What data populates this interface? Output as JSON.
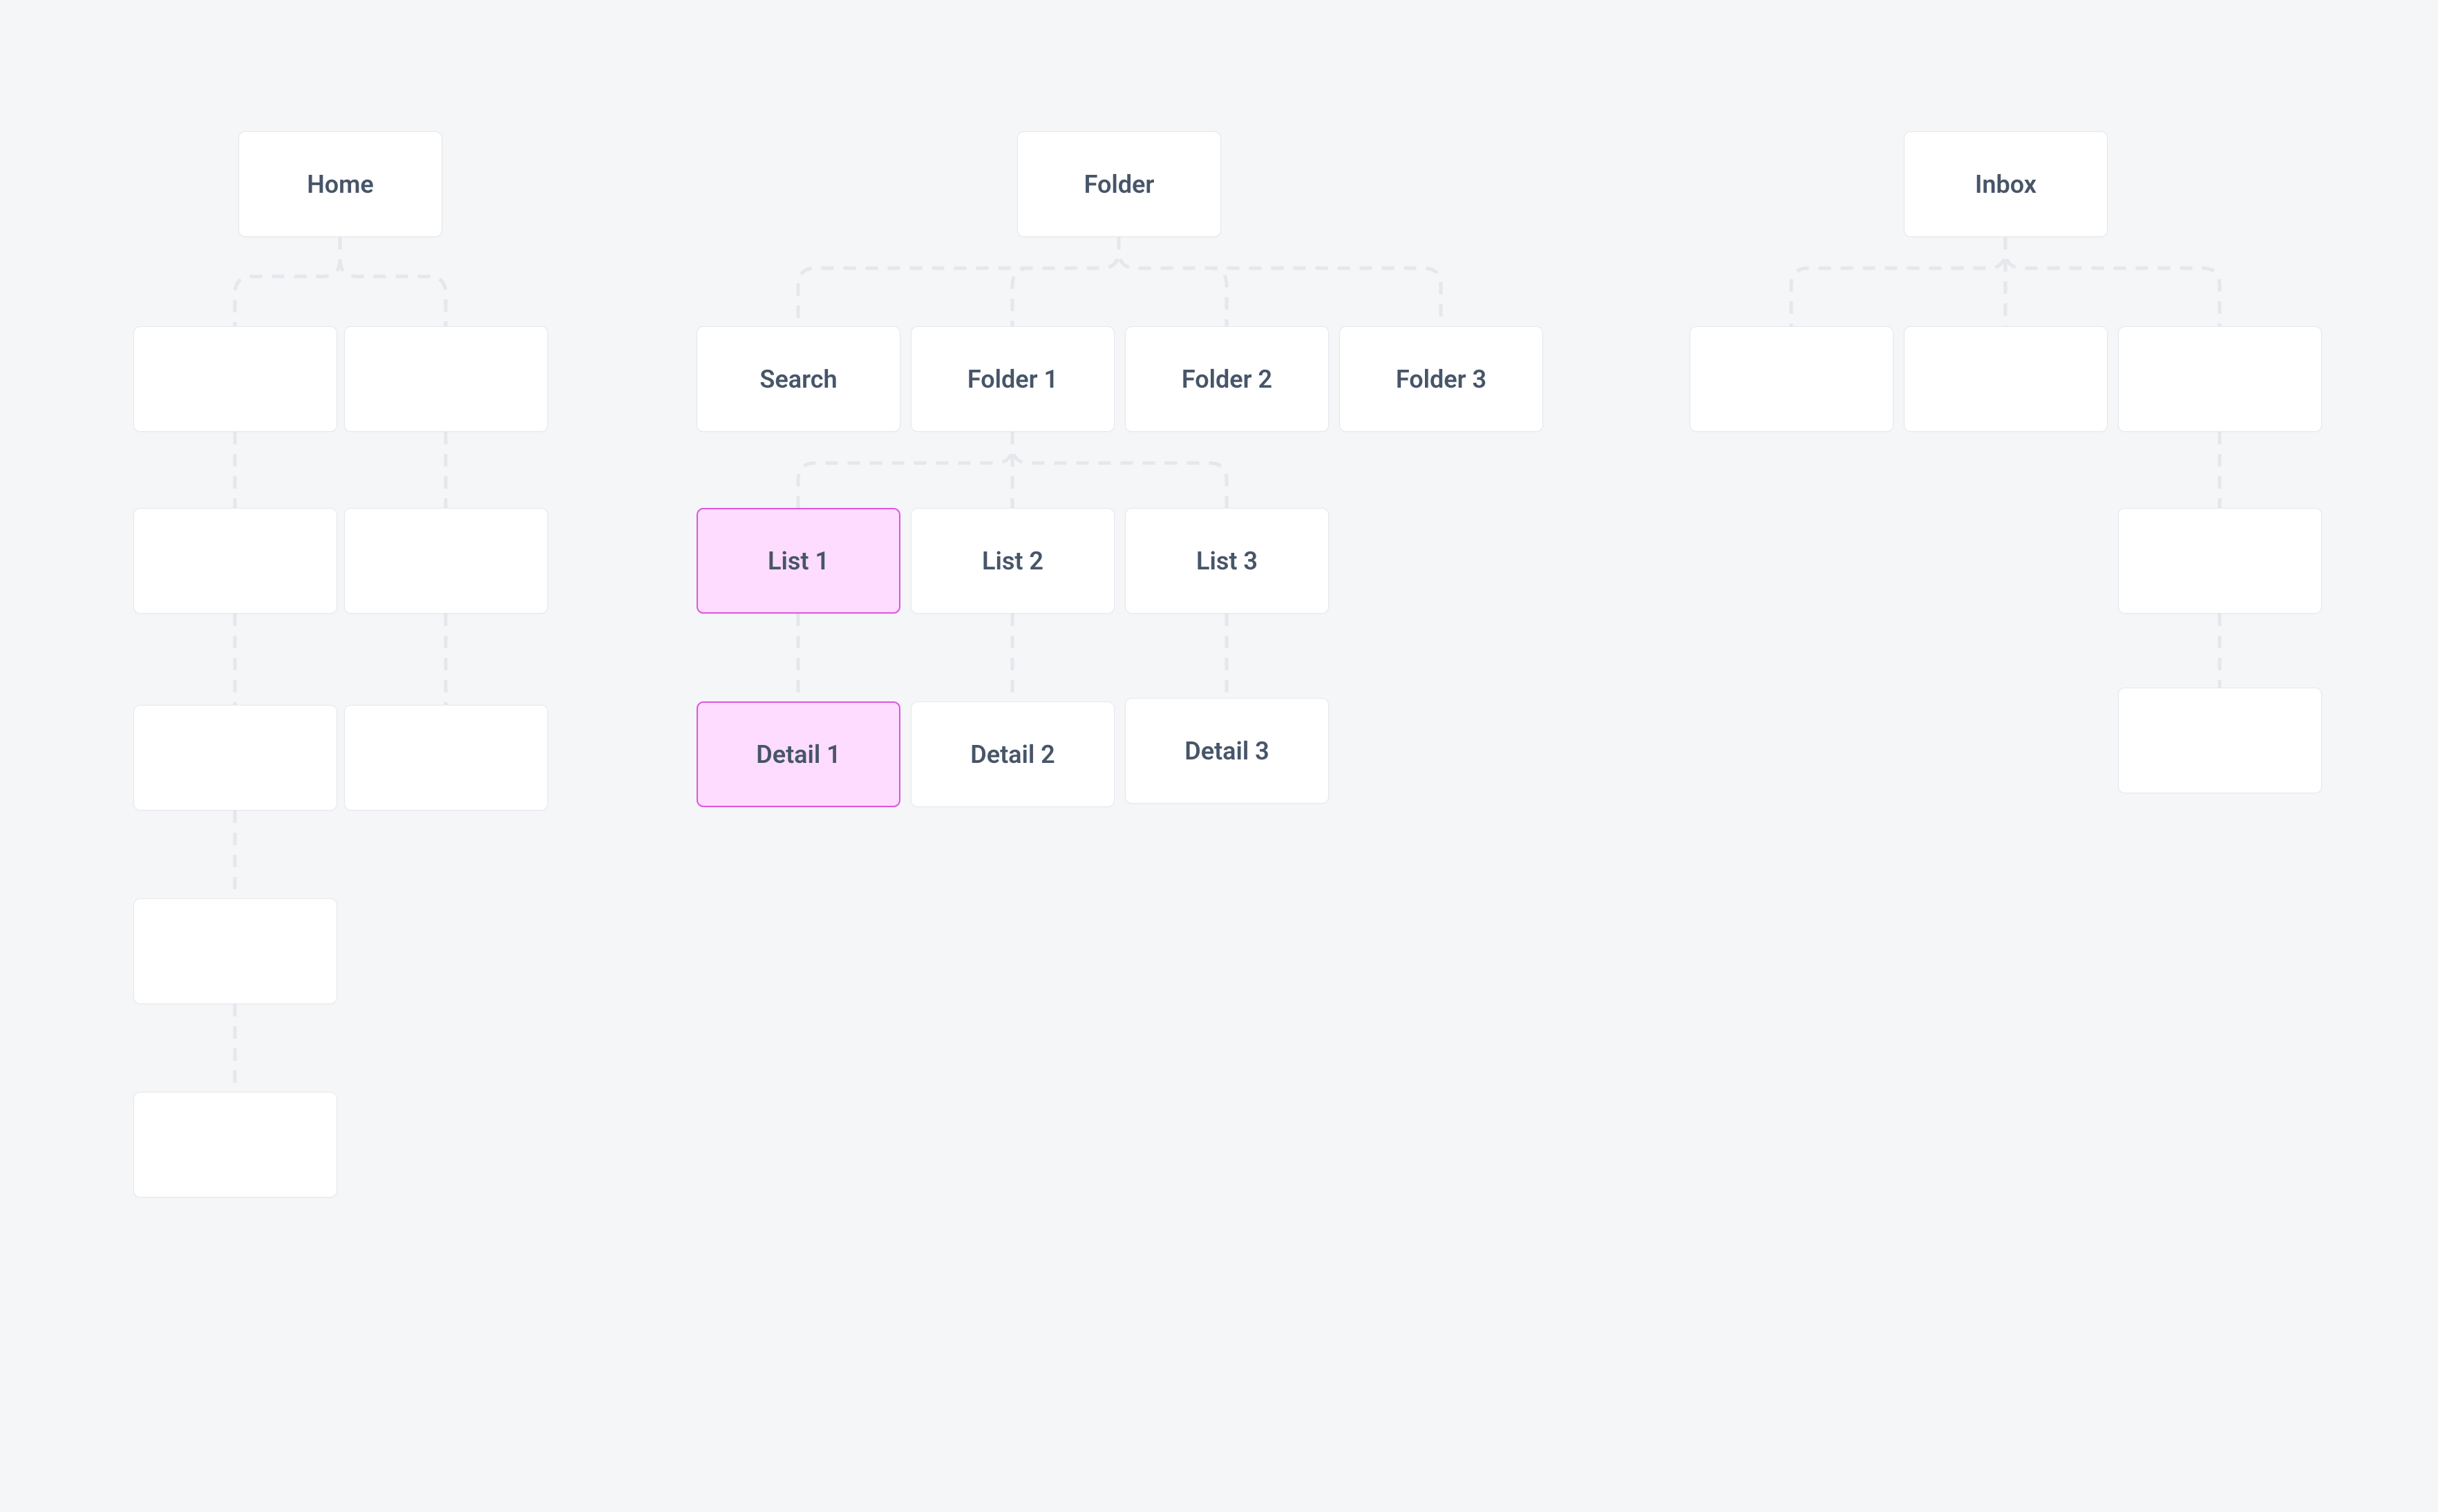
{
  "diagram": {
    "trees": [
      {
        "root": {
          "id": "home",
          "label": "Home"
        },
        "children_row1": [
          {
            "id": "home-c1",
            "label": ""
          },
          {
            "id": "home-c2",
            "label": ""
          }
        ],
        "children_row2": [
          {
            "id": "home-c3",
            "label": ""
          },
          {
            "id": "home-c4",
            "label": ""
          }
        ],
        "children_row3": [
          {
            "id": "home-c5",
            "label": ""
          },
          {
            "id": "home-c6",
            "label": ""
          }
        ],
        "children_row4": [
          {
            "id": "home-c7",
            "label": ""
          }
        ],
        "children_row5": [
          {
            "id": "home-c8",
            "label": ""
          }
        ]
      },
      {
        "root": {
          "id": "folder",
          "label": "Folder"
        },
        "children_row1": [
          {
            "id": "search",
            "label": "Search"
          },
          {
            "id": "folder1",
            "label": "Folder 1"
          },
          {
            "id": "folder2",
            "label": "Folder 2"
          },
          {
            "id": "folder3",
            "label": "Folder 3"
          }
        ],
        "children_row2": [
          {
            "id": "list1",
            "label": "List 1",
            "highlight": true
          },
          {
            "id": "list2",
            "label": "List 2"
          },
          {
            "id": "list3",
            "label": "List 3"
          }
        ],
        "children_row3": [
          {
            "id": "detail1",
            "label": "Detail 1",
            "highlight": true
          },
          {
            "id": "detail2",
            "label": "Detail 2"
          },
          {
            "id": "detail3",
            "label": "Detail 3"
          }
        ]
      },
      {
        "root": {
          "id": "inbox",
          "label": "Inbox"
        },
        "children_row1": [
          {
            "id": "inbox-c1",
            "label": ""
          },
          {
            "id": "inbox-c2",
            "label": ""
          },
          {
            "id": "inbox-c3",
            "label": ""
          }
        ],
        "children_row2": [
          {
            "id": "inbox-c4",
            "label": ""
          }
        ],
        "children_row3": [
          {
            "id": "inbox-c5",
            "label": ""
          }
        ]
      }
    ]
  },
  "colors": {
    "background": "#f5f6f8",
    "node_bg": "#ffffff",
    "node_border": "#e5e7eb",
    "node_text": "#475569",
    "highlight_bg": "#fddcff",
    "highlight_border": "#e054e0",
    "connector": "#e5e7eb"
  }
}
